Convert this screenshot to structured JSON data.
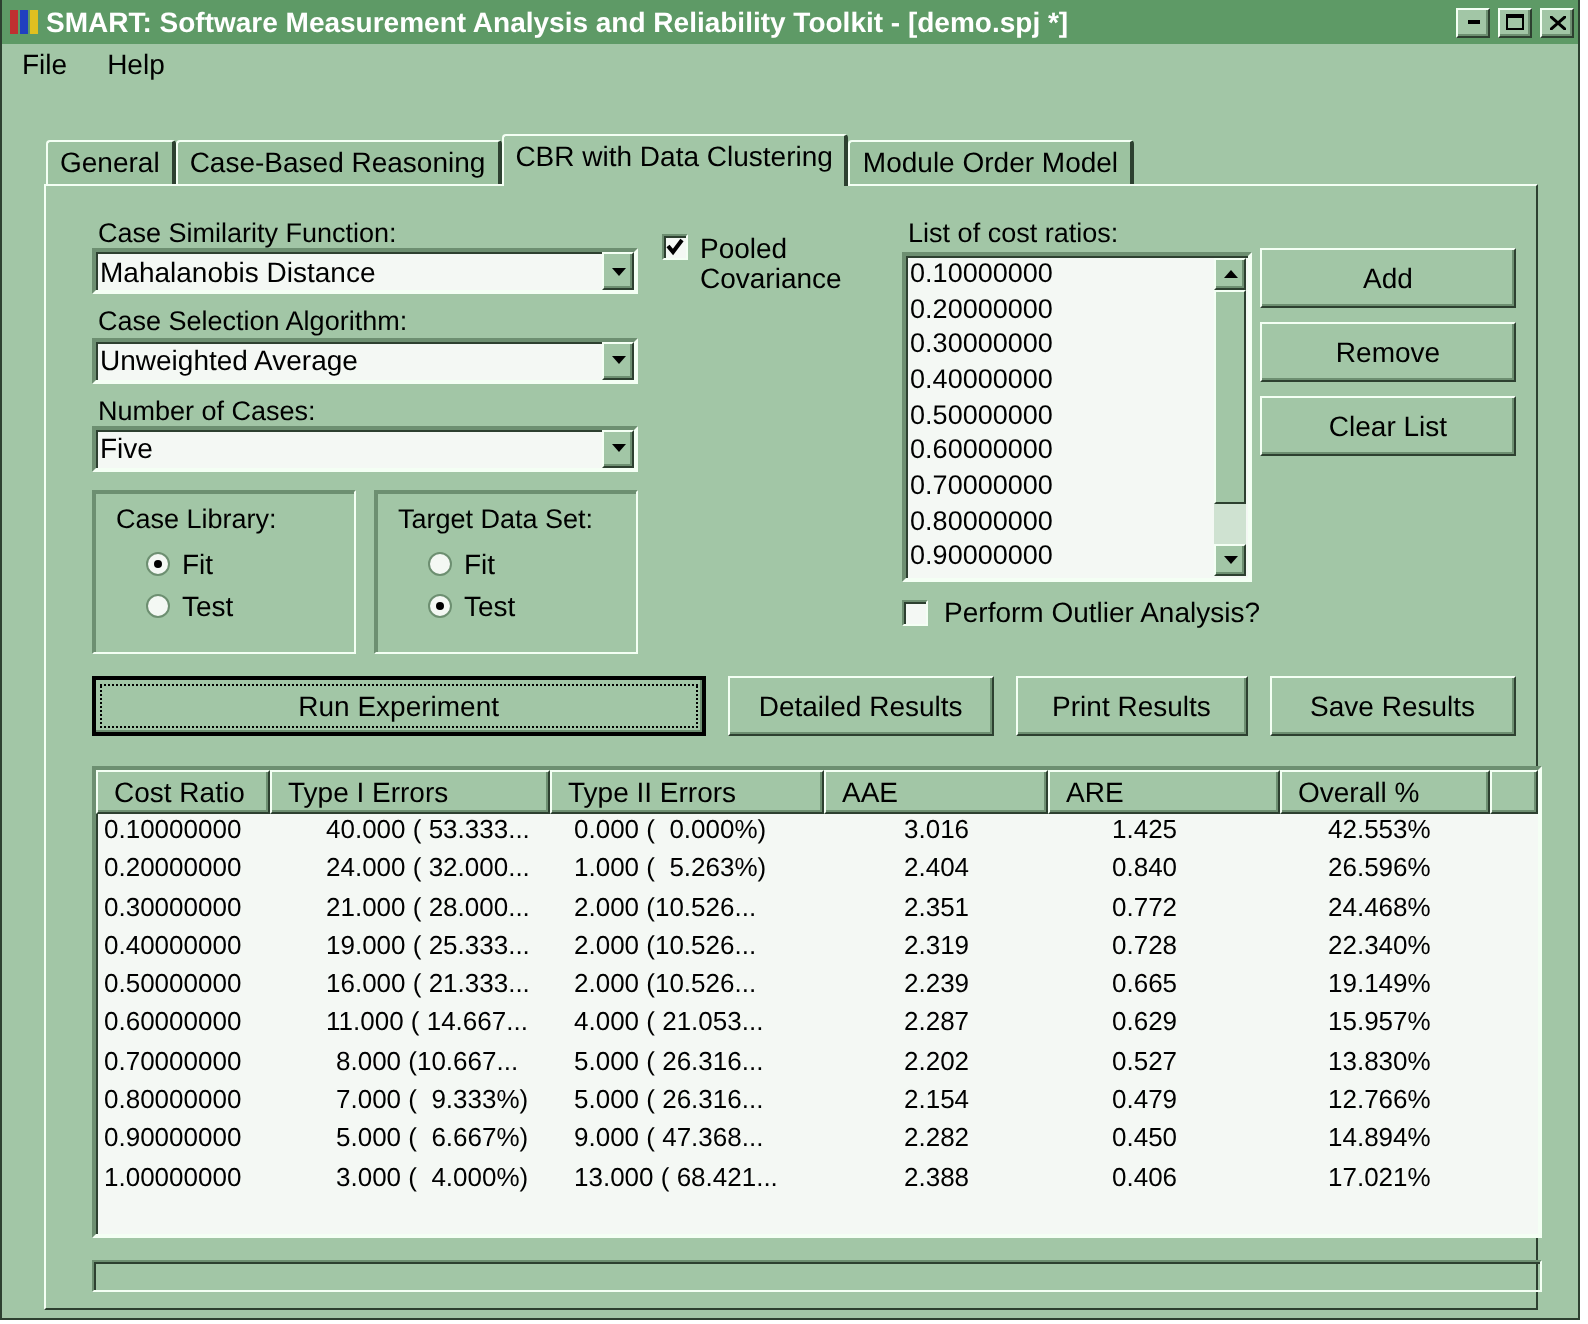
{
  "window": {
    "title": "SMART: Software Measurement Analysis and Reliability Toolkit - [demo.spj *]"
  },
  "menu": [
    {
      "label": "File"
    },
    {
      "label": "Help"
    }
  ],
  "tabs": [
    {
      "label": "General",
      "selected": false
    },
    {
      "label": "Case-Based Reasoning",
      "selected": false
    },
    {
      "label": "CBR with Data Clustering",
      "selected": true
    },
    {
      "label": "Module Order Model",
      "selected": false
    }
  ],
  "dropdowns": [
    {
      "label": "Case Similarity Function:",
      "value": "Mahalanobis Distance"
    },
    {
      "label": "Case Selection Algorithm:",
      "value": "Unweighted Average"
    },
    {
      "label": "Number of Cases:",
      "value": "Five"
    }
  ],
  "pooled_covariance": {
    "label": "Pooled Covariance",
    "checked": true
  },
  "radio_groups": [
    {
      "label": "Case Library:",
      "options": [
        {
          "label": "Fit",
          "selected": true
        },
        {
          "label": "Test",
          "selected": false
        }
      ]
    },
    {
      "label": "Target Data Set:",
      "options": [
        {
          "label": "Fit",
          "selected": false
        },
        {
          "label": "Test",
          "selected": true
        }
      ]
    }
  ],
  "cost_ratios": {
    "label": "List of cost ratios:",
    "items": [
      "0.10000000",
      "0.20000000",
      "0.30000000",
      "0.40000000",
      "0.50000000",
      "0.60000000",
      "0.70000000",
      "0.80000000",
      "0.90000000"
    ]
  },
  "list_buttons": [
    "Add",
    "Remove",
    "Clear List"
  ],
  "outlier_analysis": {
    "label": "Perform Outlier Analysis?",
    "checked": false
  },
  "action_buttons": [
    {
      "label": "Run Experiment",
      "focused": true
    },
    {
      "label": "Detailed Results",
      "focused": false
    },
    {
      "label": "Print Results",
      "focused": false
    },
    {
      "label": "Save Results",
      "focused": false
    }
  ],
  "table": {
    "columns": [
      "Cost Ratio",
      "Type I Errors",
      "Type II Errors",
      "AAE",
      "ARE",
      "Overall %"
    ],
    "rows": [
      [
        "0.10000000",
        "40.000 ( 53.333...",
        "0.000 (  0.000%)",
        "3.016",
        "1.425",
        "42.553%"
      ],
      [
        "0.20000000",
        "24.000 ( 32.000...",
        "1.000 (  5.263%)",
        "2.404",
        "0.840",
        "26.596%"
      ],
      [
        "0.30000000",
        "21.000 ( 28.000...",
        "2.000 (10.526...",
        "2.351",
        "0.772",
        "24.468%"
      ],
      [
        "0.40000000",
        "19.000 ( 25.333...",
        "2.000 (10.526...",
        "2.319",
        "0.728",
        "22.340%"
      ],
      [
        "0.50000000",
        "16.000 ( 21.333...",
        "2.000 (10.526...",
        "2.239",
        "0.665",
        "19.149%"
      ],
      [
        "0.60000000",
        "11.000 ( 14.667...",
        "4.000 ( 21.053...",
        "2.287",
        "0.629",
        "15.957%"
      ],
      [
        "0.70000000",
        "8.000 (10.667...",
        "5.000 ( 26.316...",
        "2.202",
        "0.527",
        "13.830%"
      ],
      [
        "0.80000000",
        "7.000 (  9.333%)",
        "5.000 ( 26.316...",
        "2.154",
        "0.479",
        "12.766%"
      ],
      [
        "0.90000000",
        "5.000 (  6.667%)",
        "9.000 ( 47.368...",
        "2.282",
        "0.450",
        "14.894%"
      ],
      [
        "1.00000000",
        "3.000 (  4.000%)",
        "13.000 ( 68.421...",
        "2.388",
        "0.406",
        "17.021%"
      ]
    ]
  }
}
